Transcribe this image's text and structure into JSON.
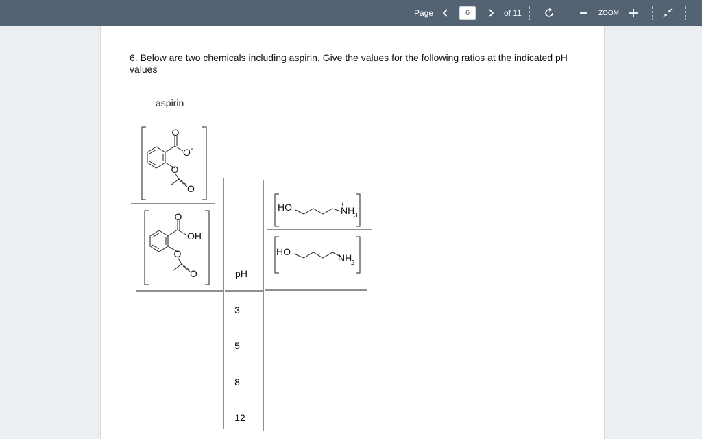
{
  "toolbar": {
    "page_label": "Page",
    "current_page": "6",
    "total_pages": "of 11",
    "zoom_label": "ZOOM",
    "prev_icon": "chevron-left-icon",
    "next_icon": "chevron-right-icon",
    "rotate_icon": "rotate-icon",
    "zoom_out_icon": "minus-icon",
    "zoom_in_icon": "plus-icon",
    "fullscreen_icon": "collapse-arrows-icon"
  },
  "document": {
    "question": "6. Below are two chemicals including aspirin. Give the values for the following ratios at the indicated pH values",
    "aspirin_label": "aspirin",
    "aspirin_top": {
      "O_carbonyl": "O",
      "O_anion": "O",
      "anion_charge": "-",
      "O_ester": "O",
      "O_acetyl": "O"
    },
    "aspirin_bottom": {
      "O_carbonyl": "O",
      "OH": "OH",
      "O_ester": "O",
      "O_acetyl": "O"
    },
    "amine_top": {
      "HO": "HO",
      "NH3": "NH",
      "NH3_sub": "3",
      "charge": "+"
    },
    "amine_bottom": {
      "HO": "HO",
      "NH2": "NH",
      "NH2_sub": "2"
    },
    "table": {
      "ph_header": "pH",
      "ph_values": [
        "3",
        "5",
        "8",
        "12"
      ]
    }
  },
  "colors": {
    "toolbar_bg": "#546373",
    "page_bg": "#ffffff",
    "canvas_bg": "#eceff1"
  }
}
